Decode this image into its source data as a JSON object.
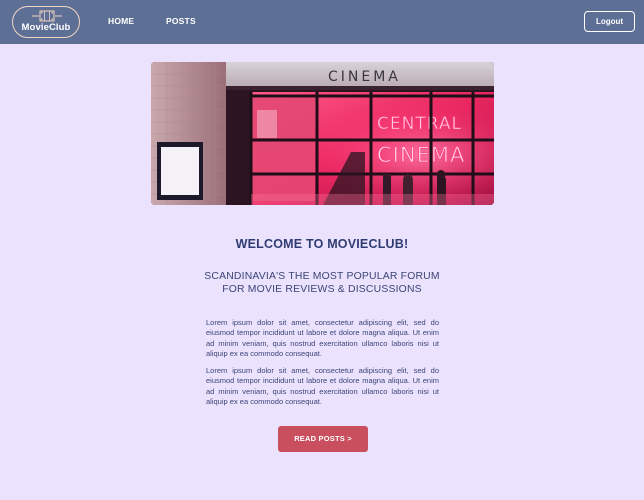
{
  "nav": {
    "logo_text": "MovieClub",
    "logo_icon": "film-strip-icon",
    "links": [
      {
        "label": "HOME"
      },
      {
        "label": "POSTS"
      }
    ],
    "logout_label": "Logout"
  },
  "hero": {
    "sign_text": "CINEMA",
    "neon_line1": "CENTRAL",
    "neon_line2": "CINEMA"
  },
  "main": {
    "welcome": "WELCOME TO MOVIECLUB!",
    "tagline_line1": "SCANDINAVIA'S THE MOST POPULAR FORUM",
    "tagline_line2": "FOR MOVIE REVIEWS & DISCUSSIONS",
    "paragraphs": [
      "Lorem ipsum dolor sit amet, consectetur adipiscing elit, sed do eiusmod tempor incididunt ut labore et dolore magna aliqua. Ut enim ad minim veniam, quis nostrud exercitation ullamco laboris nisi ut aliquip ex ea commodo consequat.",
      "Lorem ipsum dolor sit amet, consectetur adipiscing elit, sed do eiusmod tempor incididunt ut labore et dolore magna aliqua. Ut enim ad minim veniam, quis nostrud exercitation ullamco laboris nisi ut aliquip ex ea commodo consequat."
    ],
    "cta_label": "READ POSTS >"
  },
  "colors": {
    "background": "#ebe2fd",
    "navbar": "#5e6f95",
    "heading": "#2f3c73",
    "cta": "#c94f5f",
    "neon": "#ff3d7f"
  }
}
